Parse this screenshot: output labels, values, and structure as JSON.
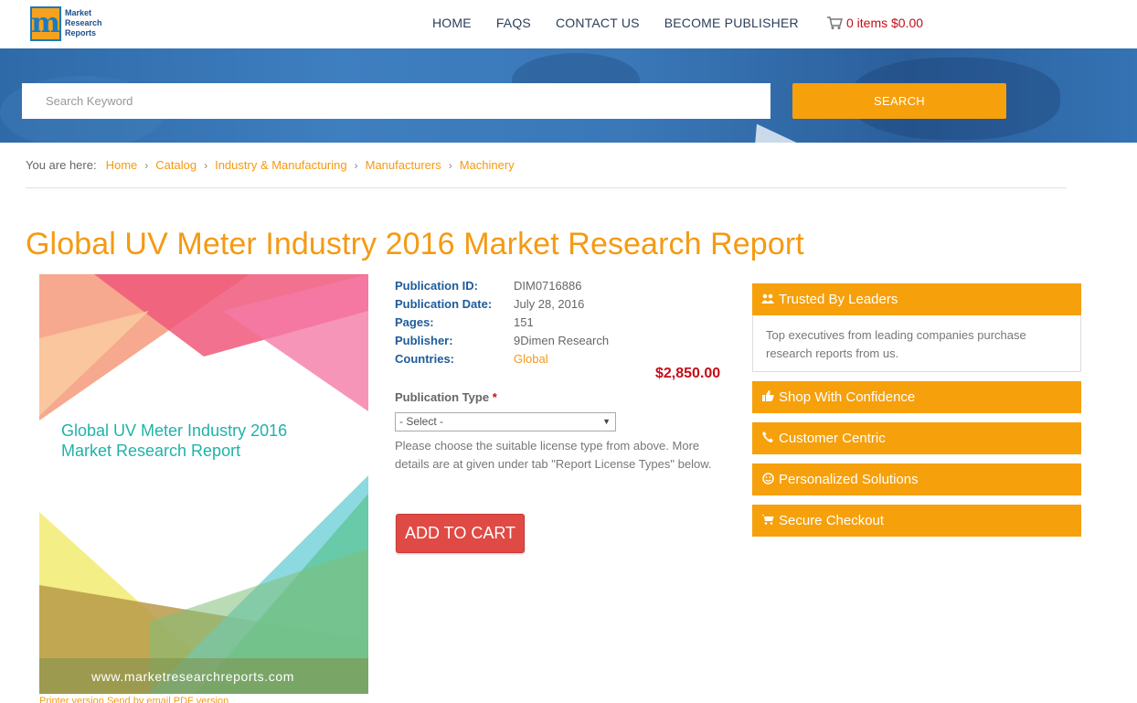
{
  "header": {
    "logo_lines": [
      "Market",
      "Research",
      "Reports"
    ],
    "nav": [
      "HOME",
      "FAQS",
      "CONTACT US",
      "BECOME PUBLISHER"
    ],
    "cart_text": "0 items $0.00"
  },
  "search": {
    "placeholder": "Search Keyword",
    "button_label": "SEARCH"
  },
  "breadcrumb": {
    "label": "You are here:",
    "items": [
      "Home",
      "Catalog",
      "Industry & Manufacturing",
      "Manufacturers",
      "Machinery"
    ]
  },
  "page_title": "Global UV Meter Industry 2016 Market Research Report",
  "cover": {
    "title": "Global UV Meter Industry 2016 Market Research Report",
    "url": "www.marketresearchreports.com"
  },
  "under_cover": "Printer version    Send by email    PDF version",
  "details": {
    "rows": [
      {
        "key": "Publication ID:",
        "value": "DIM0716886"
      },
      {
        "key": "Publication Date:",
        "value": "July 28, 2016"
      },
      {
        "key": "Pages:",
        "value": "151"
      },
      {
        "key": "Publisher:",
        "value": "9Dimen Research"
      },
      {
        "key": "Countries:",
        "value": "Global"
      }
    ],
    "price": "$2,850.00",
    "publication_type_label": "Publication Type",
    "required_mark": "*",
    "select_value": "- Select -",
    "help_text": "Please choose the suitable license type from above. More details are at given under tab \"Report License Types\" below.",
    "add_to_cart": "ADD TO CART"
  },
  "panels": [
    {
      "title": "Trusted By Leaders",
      "icon": "users-icon",
      "body": "Top executives from leading companies purchase research reports from us."
    },
    {
      "title": "Shop With Confidence",
      "icon": "thumbs-up-icon"
    },
    {
      "title": "Customer Centric",
      "icon": "phone-icon"
    },
    {
      "title": "Personalized Solutions",
      "icon": "smile-icon"
    },
    {
      "title": "Secure Checkout",
      "icon": "cart-icon"
    }
  ],
  "colors": {
    "accent": "#f6a00c",
    "title": "#f49a12",
    "price": "#c40d16",
    "add_to_cart": "#e04a44",
    "detail_key": "#1e5b9a"
  }
}
